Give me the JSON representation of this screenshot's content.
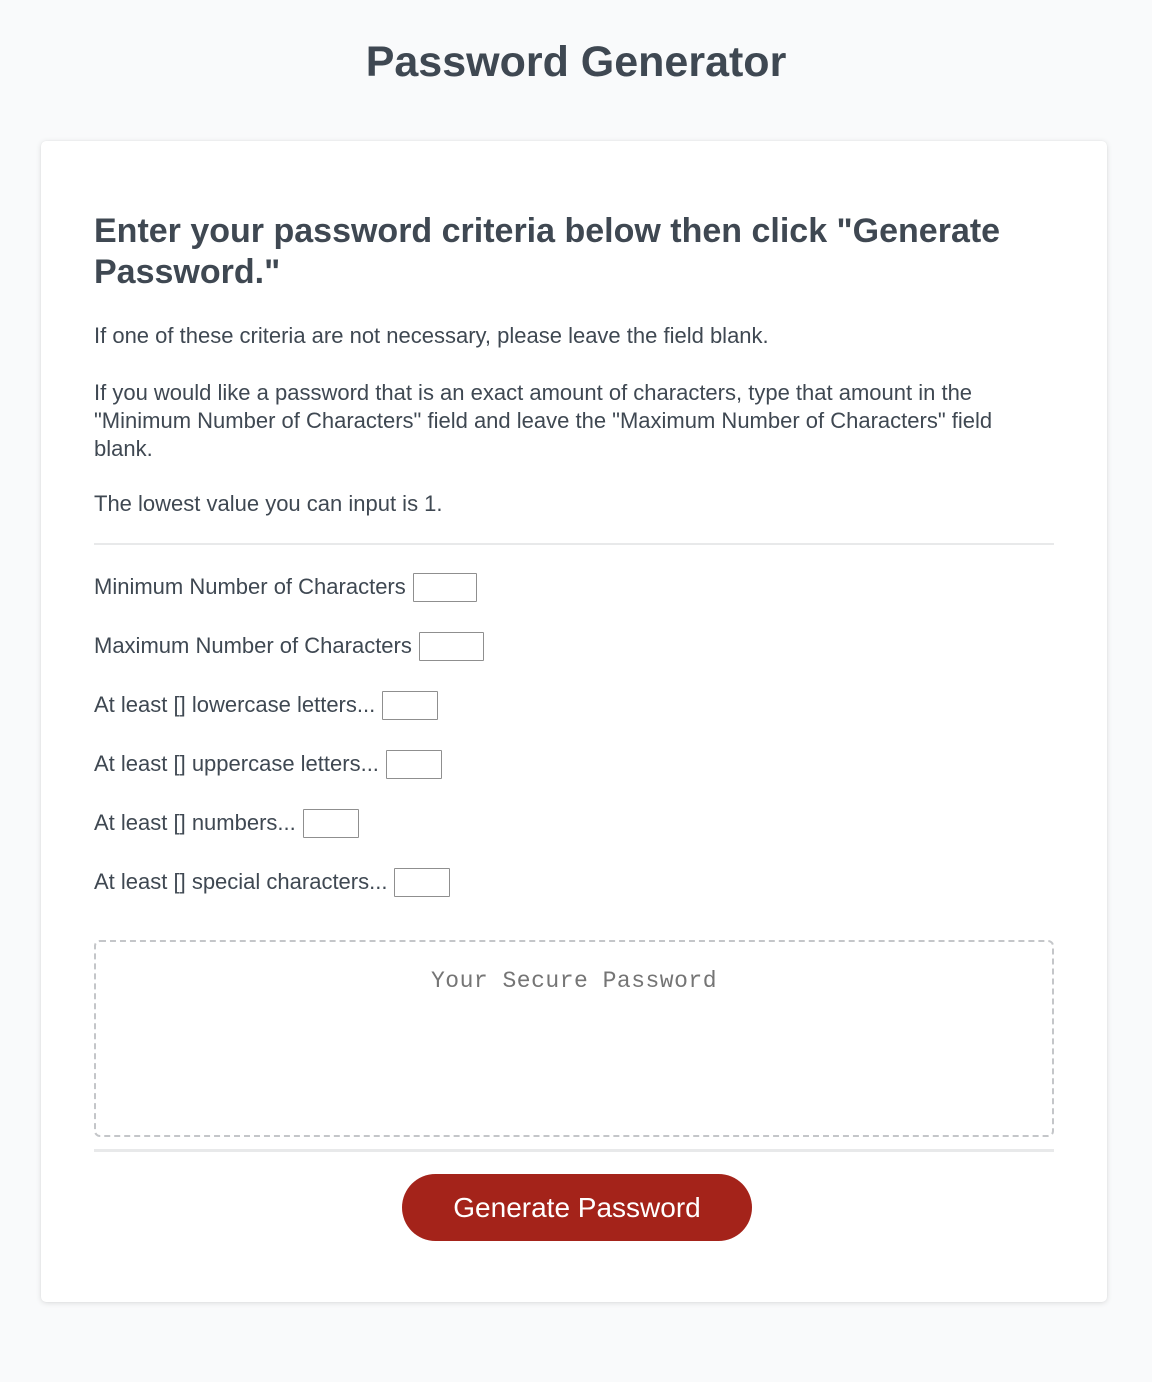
{
  "header": {
    "title": "Password Generator"
  },
  "card": {
    "heading": "Enter your password criteria below then click \"Generate Password.\"",
    "instructions": [
      "If one of these criteria are not necessary, please leave the field blank.",
      "If you would like a password that is an exact amount of characters, type that amount in the \"Minimum Number of Characters\" field and leave the \"Maximum Number of Characters\" field blank.",
      "The lowest value you can input is 1."
    ],
    "fields": [
      {
        "label": "Minimum Number of Characters",
        "value": ""
      },
      {
        "label": "Maximum Number of Characters",
        "value": ""
      },
      {
        "label": "At least [] lowercase letters...",
        "value": ""
      },
      {
        "label": "At least [] uppercase letters...",
        "value": ""
      },
      {
        "label": "At least [] numbers...",
        "value": ""
      },
      {
        "label": "At least [] special characters...",
        "value": ""
      }
    ],
    "password_output": {
      "placeholder": "Your Secure Password",
      "value": ""
    },
    "generate_button_label": "Generate Password"
  },
  "colors": {
    "background": "#f9fafb",
    "text": "#3f4852",
    "button": "#a4231a",
    "button_text": "#ffffff"
  }
}
